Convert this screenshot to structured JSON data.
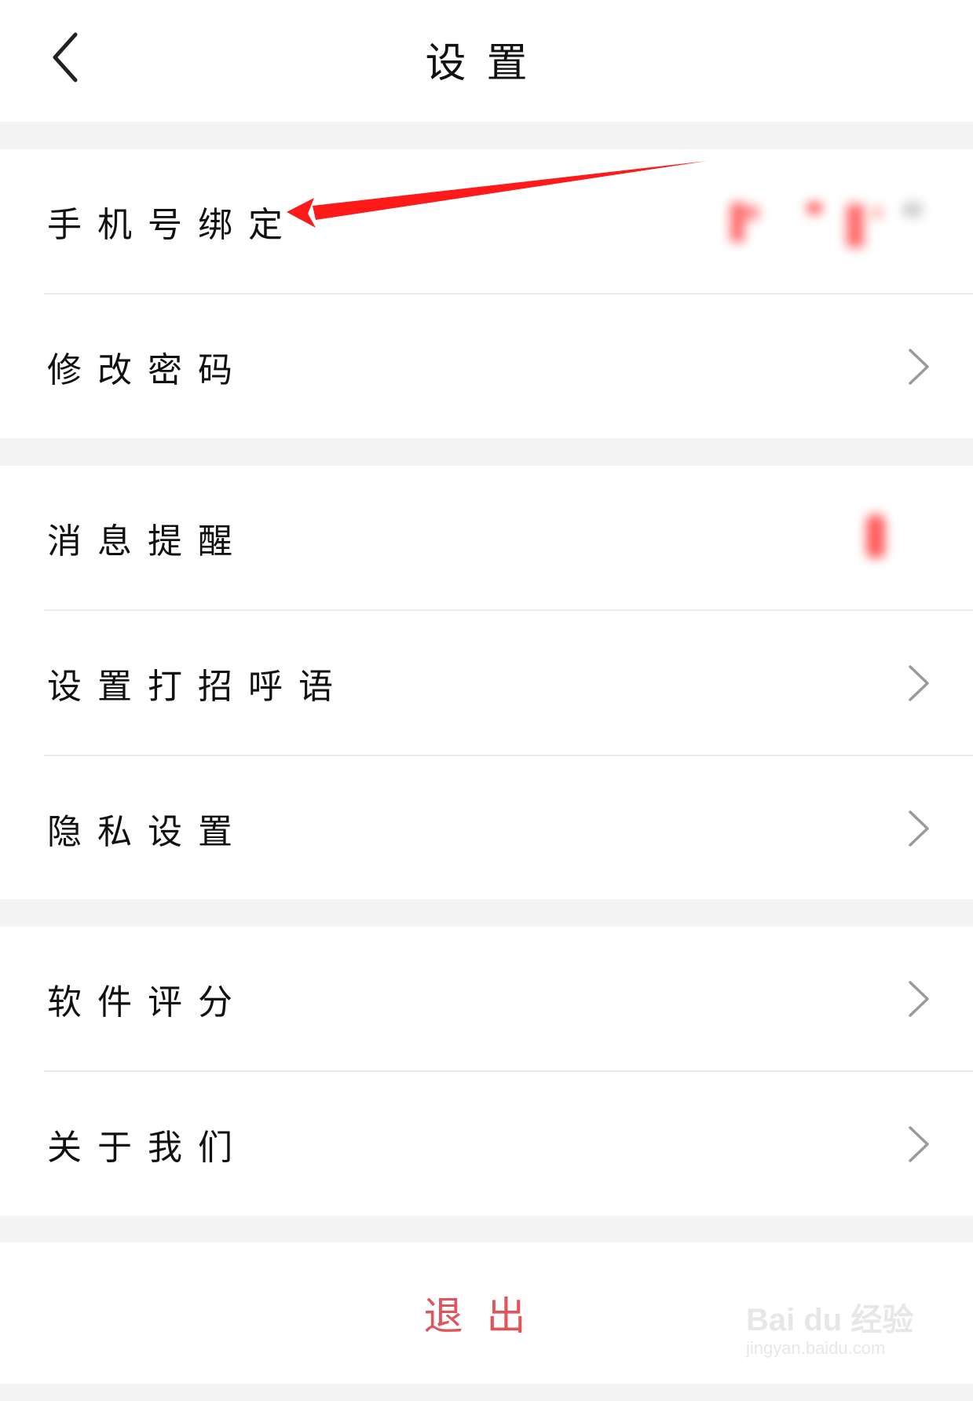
{
  "header": {
    "title": "设置",
    "back_icon": "chevron-left-icon"
  },
  "groups": [
    {
      "rows": [
        {
          "label": "手机号绑定",
          "has_chevron": false
        },
        {
          "label": "修改密码",
          "has_chevron": true
        }
      ]
    },
    {
      "rows": [
        {
          "label": "消息提醒",
          "has_chevron": false
        },
        {
          "label": "设置打招呼语",
          "has_chevron": true
        },
        {
          "label": "隐私设置",
          "has_chevron": true
        }
      ]
    },
    {
      "rows": [
        {
          "label": "软件评分",
          "has_chevron": true
        },
        {
          "label": "关于我们",
          "has_chevron": true
        }
      ]
    }
  ],
  "logout": {
    "label": "退出"
  },
  "annotation": {
    "color": "#ff1a1a"
  },
  "watermark": {
    "logo": "Bai du 经验",
    "url": "jingyan.baidu.com"
  },
  "colors": {
    "accent": "#e0545c",
    "gap": "#f4f4f5",
    "divider": "#ebebeb"
  }
}
